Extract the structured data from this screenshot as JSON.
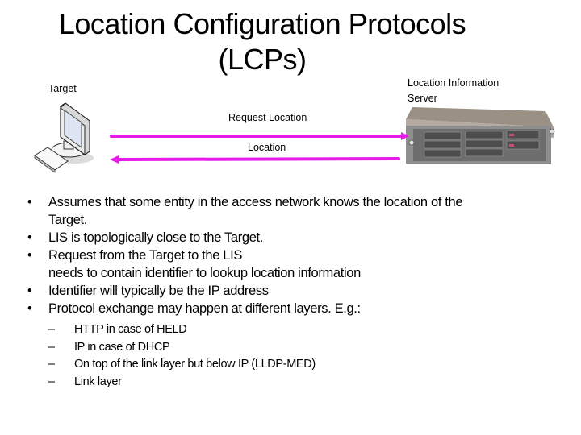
{
  "slide": {
    "title_line1": "Location Configuration Protocols",
    "title_line2": "(LCPs)"
  },
  "diagram": {
    "target_label": "Target",
    "server_label_line1": "Location Information",
    "server_label_line2": "Server",
    "request_arrow_label": "Request Location",
    "response_arrow_label": "Location",
    "arrow_color": "#e81ce8",
    "target_icon": "desktop-computer-icon",
    "server_icon": "rack-server-icon"
  },
  "bullets": [
    {
      "line1": "Assumes that some entity in the access network knows the location of the",
      "line2": "Target."
    },
    {
      "line1": "LIS is topologically close to the Target.",
      "line2": ""
    },
    {
      "line1": "Request from the Target to the LIS",
      "line2": "needs to contain identifier to lookup location information"
    },
    {
      "line1": "Identifier will typically be the IP address",
      "line2": ""
    },
    {
      "line1": "Protocol exchange may happen at different layers. E.g.:",
      "line2": ""
    }
  ],
  "bullet_symbol": "•",
  "sub_symbol": "–",
  "sub_bullets": [
    "HTTP in case of HELD",
    "IP in case of DHCP",
    "On top of the link layer but below IP (LLDP-MED)",
    "Link layer"
  ]
}
